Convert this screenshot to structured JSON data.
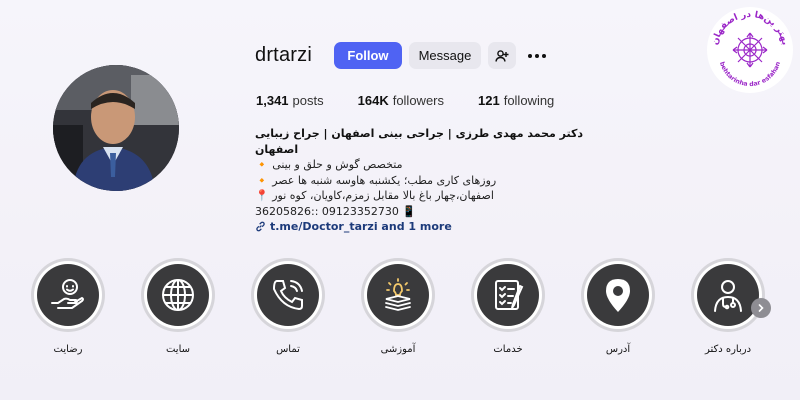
{
  "profile": {
    "username": "drtarzi",
    "follow_label": "Follow",
    "message_label": "Message"
  },
  "icons": {
    "add_user": "add-user-icon",
    "more": "more-options-icon",
    "link": "link-icon"
  },
  "stats": {
    "posts_count": "1,341",
    "posts_label": "posts",
    "followers_count": "164K",
    "followers_label": "followers",
    "following_count": "121",
    "following_label": "following"
  },
  "bio": {
    "title": "دکتر محمد مهدی طرزی | جراحی بینی اصفهان | جراح زیبایی اصفهان",
    "line1": "متخصص گوش و حلق و بینی 🔸",
    "line2": "روزهای کاری مطب؛ یکشنبه هاوسه شنبه ها عصر 🔸",
    "line3": "اصفهان،چهار باغ بالا مقابل زمزم،کاویان، کوه نور 📍",
    "phones": "36205826:: 09123352730 📱",
    "link": "t.me/Doctor_tarzi and 1 more"
  },
  "logo": {
    "text_top": "بهتر ین‌ها در اصفهان",
    "text_bottom": "behtarinha dar esfahan"
  },
  "highlights": [
    {
      "label": "رضایت",
      "icon": "satisfaction-icon"
    },
    {
      "label": "سایت",
      "icon": "globe-icon"
    },
    {
      "label": "تماس",
      "icon": "phone-icon"
    },
    {
      "label": "آموزشی",
      "icon": "education-icon"
    },
    {
      "label": "خدمات",
      "icon": "checklist-icon"
    },
    {
      "label": "آدرس",
      "icon": "location-pin-icon"
    },
    {
      "label": "درباره دکتر",
      "icon": "doctor-icon"
    }
  ],
  "colors": {
    "accent": "#4f63f3",
    "secondary_button": "#e8e7ee",
    "highlight_core": "#3a3a3c",
    "logo": "#9b27c8"
  }
}
